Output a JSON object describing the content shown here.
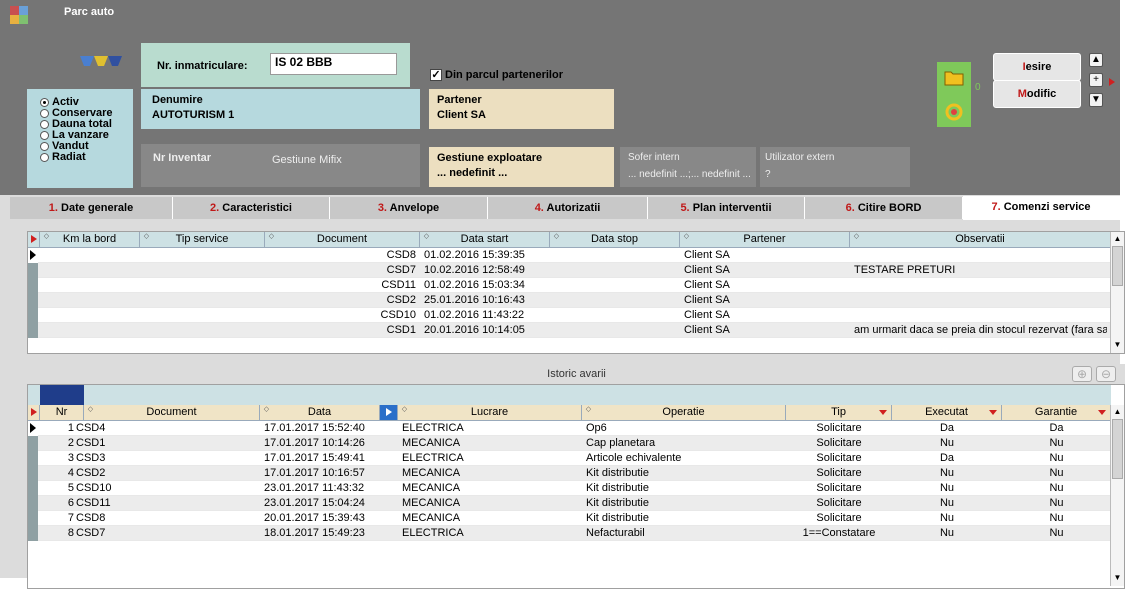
{
  "window": {
    "title": "Parc auto"
  },
  "status": {
    "options": [
      "Activ",
      "Conservare",
      "Dauna total",
      "La vanzare",
      "Vandut",
      "Radiat"
    ],
    "selected": "Activ"
  },
  "vehicle": {
    "plate_label": "Nr. inmatriculare:",
    "plate_value": "IS 02 BBB",
    "name_label": "Denumire",
    "name_value": "AUTOTURISM 1",
    "inventory_label": "Nr Inventar",
    "inventory_mgmt": "Gestiune Mifix"
  },
  "partner": {
    "checkbox_label": "Din parcul partenerilor",
    "checkbox_mark": "✓",
    "label": "Partener",
    "value": "Client SA"
  },
  "exploitation": {
    "label": "Gestiune exploatare",
    "value": "... nedefinit ..."
  },
  "driver": {
    "label": "Sofer intern",
    "value": "... nedefinit ...;... nedefinit ..."
  },
  "ext_user": {
    "label": "Utilizator extern",
    "value": "?"
  },
  "side": {
    "counter": "0"
  },
  "buttons": {
    "exit_hot": "I",
    "exit_rest": "esire",
    "modify_hot": "M",
    "modify_rest": "odific",
    "up": "▲",
    "plus": "+",
    "down": "▼"
  },
  "tabs": [
    {
      "num": "1.",
      "label": "Date generale"
    },
    {
      "num": "2.",
      "label": "Caracteristici"
    },
    {
      "num": "3.",
      "label": "Anvelope"
    },
    {
      "num": "4.",
      "label": "Autorizatii"
    },
    {
      "num": "5.",
      "label": "Plan interventii"
    },
    {
      "num": "6.",
      "label": "Citire BORD"
    },
    {
      "num": "7.",
      "label": "Comenzi service"
    }
  ],
  "orders": {
    "columns": [
      "Km la bord",
      "Tip service",
      "Document",
      "Data start",
      "Data stop",
      "Partener",
      "Observatii"
    ],
    "rows": [
      {
        "km": "",
        "tip": "",
        "doc": "CSD8",
        "start": "01.02.2016 15:39:35",
        "stop": "",
        "partner": "Client SA",
        "obs": ""
      },
      {
        "km": "",
        "tip": "",
        "doc": "CSD7",
        "start": "10.02.2016 12:58:49",
        "stop": "",
        "partner": "Client SA",
        "obs": "TESTARE PRETURI"
      },
      {
        "km": "",
        "tip": "",
        "doc": "CSD11",
        "start": "01.02.2016 15:03:34",
        "stop": "",
        "partner": "Client SA",
        "obs": ""
      },
      {
        "km": "",
        "tip": "",
        "doc": "CSD2",
        "start": "25.01.2016 10:16:43",
        "stop": "",
        "partner": "Client SA",
        "obs": ""
      },
      {
        "km": "",
        "tip": "",
        "doc": "CSD10",
        "start": "01.02.2016 11:43:22",
        "stop": "",
        "partner": "Client SA",
        "obs": ""
      },
      {
        "km": "",
        "tip": "",
        "doc": "CSD1",
        "start": "20.01.2016 10:14:05",
        "stop": "",
        "partner": "Client SA",
        "obs": "am urmarit daca se preia din stocul rezervat (fara sa am"
      }
    ]
  },
  "history": {
    "title": "Istoric avarii",
    "add_icon": "⊕",
    "remove_icon": "⊖",
    "columns": [
      "Nr",
      "Document",
      "Data",
      "Lucrare",
      "Operatie",
      "Tip",
      "Executat",
      "Garantie"
    ],
    "rows": [
      {
        "nr": "1",
        "doc": "CSD4",
        "date": "17.01.2017 15:52:40",
        "work": "ELECTRICA",
        "op": "Op6",
        "type": "Solicitare",
        "done": "Da",
        "warranty": "Da"
      },
      {
        "nr": "2",
        "doc": "CSD1",
        "date": "17.01.2017 10:14:26",
        "work": "MECANICA",
        "op": "Cap planetara",
        "type": "Solicitare",
        "done": "Nu",
        "warranty": "Nu"
      },
      {
        "nr": "3",
        "doc": "CSD3",
        "date": "17.01.2017 15:49:41",
        "work": "ELECTRICA",
        "op": "Articole echivalente",
        "type": "Solicitare",
        "done": "Da",
        "warranty": "Nu"
      },
      {
        "nr": "4",
        "doc": "CSD2",
        "date": "17.01.2017 10:16:57",
        "work": "MECANICA",
        "op": "Kit distributie",
        "type": "Solicitare",
        "done": "Nu",
        "warranty": "Nu"
      },
      {
        "nr": "5",
        "doc": "CSD10",
        "date": "23.01.2017 11:43:32",
        "work": "MECANICA",
        "op": "Kit distributie",
        "type": "Solicitare",
        "done": "Nu",
        "warranty": "Nu"
      },
      {
        "nr": "6",
        "doc": "CSD11",
        "date": "23.01.2017 15:04:24",
        "work": "MECANICA",
        "op": "Kit distributie",
        "type": "Solicitare",
        "done": "Nu",
        "warranty": "Nu"
      },
      {
        "nr": "7",
        "doc": "CSD8",
        "date": "20.01.2017 15:39:43",
        "work": "MECANICA",
        "op": "Kit distributie",
        "type": "Solicitare",
        "done": "Nu",
        "warranty": "Nu"
      },
      {
        "nr": "8",
        "doc": "CSD7",
        "date": "18.01.2017 15:49:23",
        "work": "ELECTRICA",
        "op": "Nefacturabil",
        "type": "1==Constatare",
        "done": "Nu",
        "warranty": "Nu"
      }
    ]
  },
  "colors": {
    "header": "#757575",
    "green_box": "#b9dccf",
    "blue_box": "#b6d9de",
    "beige_box": "#ecdfc0",
    "accent_red": "#c01818"
  }
}
